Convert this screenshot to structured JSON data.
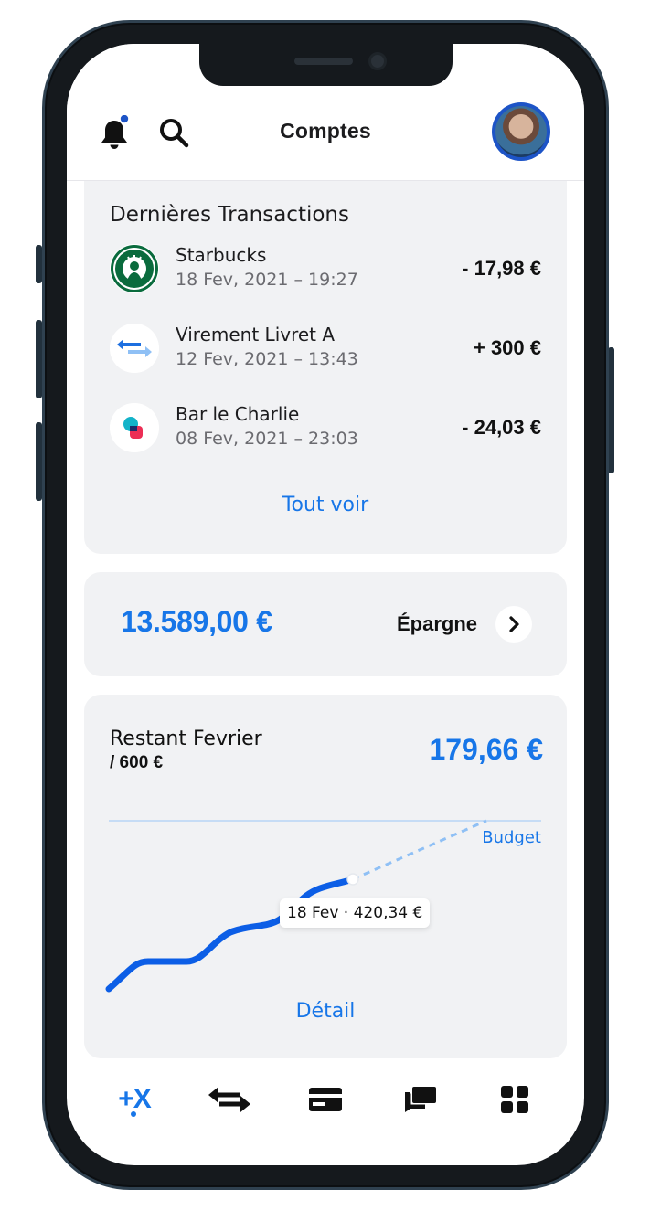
{
  "header": {
    "title": "Comptes",
    "notification_dot": true
  },
  "transactions": {
    "section_title": "Dernières Transactions",
    "items": [
      {
        "name": "Starbucks",
        "date": "18 Fev, 2021 – 19:27",
        "amount": "- 17,98 €",
        "icon": "starbucks-logo-icon"
      },
      {
        "name": "Virement Livret A",
        "date": "12 Fev, 2021 – 13:43",
        "amount": "+ 300 €",
        "icon": "transfer-arrows-icon"
      },
      {
        "name": "Bar le Charlie",
        "date": "08 Fev, 2021 – 23:03",
        "amount": "- 24,03 €",
        "icon": "bar-logo-icon"
      }
    ],
    "see_all": "Tout voir"
  },
  "savings": {
    "amount": "13.589,00 €",
    "label": "Épargne"
  },
  "budget": {
    "title": "Restant Fevrier",
    "subtitle": "/ 600 €",
    "amount": "179,66 €",
    "line_label": "Budget",
    "tooltip": "18 Fev · 420,34 €",
    "detail": "Détail"
  },
  "colors": {
    "accent": "#1776e8",
    "card": "#f1f2f4",
    "text": "#111111"
  },
  "tabbar": {
    "items": [
      {
        "name": "plusx",
        "label": "+X",
        "active": true
      },
      {
        "name": "transfers",
        "icon": "transfer-icon"
      },
      {
        "name": "cards",
        "icon": "card-icon"
      },
      {
        "name": "messages",
        "icon": "chat-icon"
      },
      {
        "name": "apps",
        "icon": "grid-icon"
      }
    ]
  }
}
